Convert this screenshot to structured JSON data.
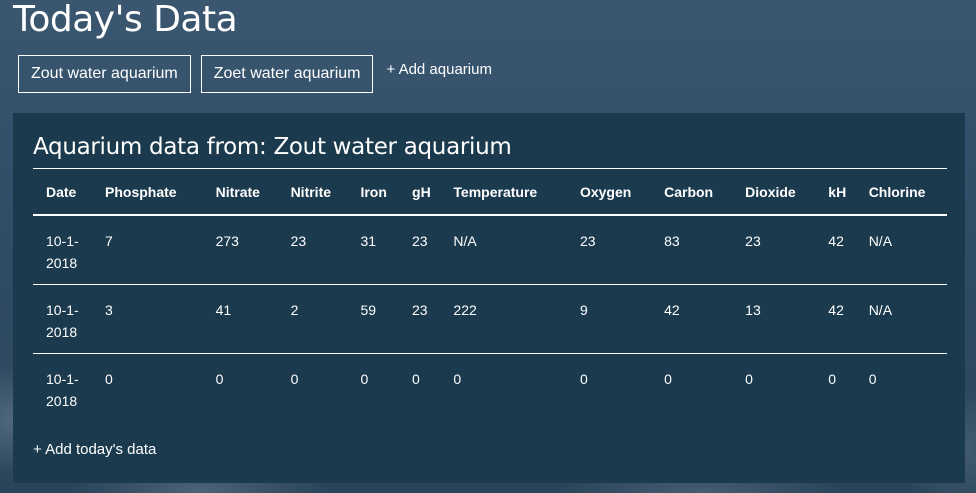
{
  "page": {
    "title": "Today's Data"
  },
  "tabs": [
    {
      "label": "Zout water aquarium"
    },
    {
      "label": "Zoet water aquarium"
    }
  ],
  "add_aquarium_label": "+ Add aquarium",
  "panel": {
    "heading": "Aquarium data from: Zout water aquarium",
    "columns": [
      "Date",
      "Phosphate",
      "Nitrate",
      "Nitrite",
      "Iron",
      "gH",
      "Temperature",
      "Oxygen",
      "Carbon",
      "Dioxide",
      "kH",
      "Chlorine"
    ],
    "rows": [
      [
        "10-1-2018",
        "7",
        "273",
        "23",
        "31",
        "23",
        "N/A",
        "23",
        "83",
        "23",
        "42",
        "N/A"
      ],
      [
        "10-1-2018",
        "3",
        "41",
        "2",
        "59",
        "23",
        "222",
        "9",
        "42",
        "13",
        "42",
        "N/A"
      ],
      [
        "10-1-2018",
        "0",
        "0",
        "0",
        "0",
        "0",
        "0",
        "0",
        "0",
        "0",
        "0",
        "0"
      ]
    ],
    "add_data_label": "+ Add today's data"
  },
  "colors": {
    "background": "#33506a",
    "panel": "#1b3a4d",
    "text": "#ffffff"
  }
}
